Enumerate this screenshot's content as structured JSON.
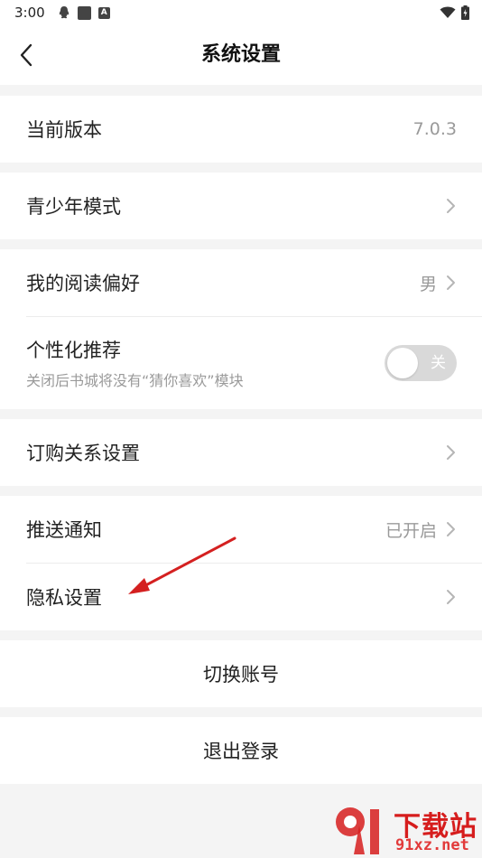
{
  "status_bar": {
    "time": "3:00",
    "icons": [
      "qq-icon",
      "notification-square-icon",
      "a-badge-icon",
      "wifi-icon",
      "battery-icon"
    ]
  },
  "nav": {
    "title": "系统设置",
    "back_icon": "chevron-left-icon"
  },
  "sections": [
    {
      "rows": [
        {
          "label": "当前版本",
          "value": "7.0.3"
        }
      ]
    },
    {
      "rows": [
        {
          "label": "青少年模式",
          "value": ""
        }
      ]
    },
    {
      "rows": [
        {
          "label": "我的阅读偏好",
          "value": "男"
        },
        {
          "label": "个性化推荐",
          "subtitle": "关闭后书城将没有“猜你喜欢”模块",
          "toggle": "关"
        }
      ]
    },
    {
      "rows": [
        {
          "label": "订购关系设置",
          "value": ""
        }
      ]
    },
    {
      "rows": [
        {
          "label": "推送通知",
          "value": "已开启"
        },
        {
          "label": "隐私设置",
          "value": ""
        }
      ]
    }
  ],
  "actions": {
    "switch_account": "切换账号",
    "logout": "退出登录"
  },
  "watermark": {
    "line1": "下载站",
    "line2": "91xz.net"
  },
  "colors": {
    "background": "#f4f4f4",
    "card": "#ffffff",
    "secondary_text": "#9a9a9a",
    "toggle_off": "#d9d9d9",
    "annotation_arrow": "#d42020",
    "watermark_red": "#d61d1d"
  }
}
